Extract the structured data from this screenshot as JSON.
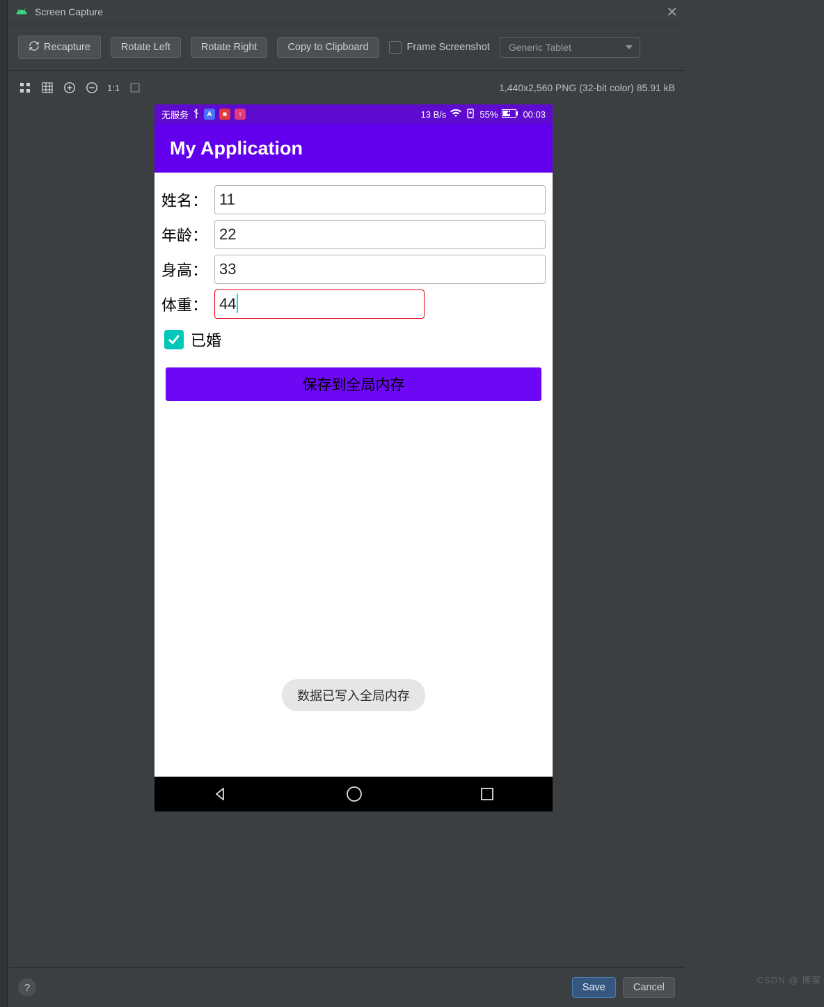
{
  "window": {
    "title": "Screen Capture"
  },
  "toolbar": {
    "recapture": "Recapture",
    "rotate_left": "Rotate Left",
    "rotate_right": "Rotate Right",
    "copy_clipboard": "Copy to Clipboard",
    "frame_screenshot": "Frame Screenshot",
    "device_dropdown": "Generic Tablet",
    "zoom_ratio": "1:1",
    "image_info": "1,440x2,560 PNG (32-bit color) 85.91 kB"
  },
  "device": {
    "status": {
      "carrier": "无服务",
      "speed": "13 B/s",
      "battery": "55%",
      "time": "00:03"
    },
    "app_title": "My Application",
    "form": {
      "name": {
        "label": "姓名：",
        "value": "11"
      },
      "age": {
        "label": "年龄：",
        "value": "22"
      },
      "height": {
        "label": "身高：",
        "value": "33"
      },
      "weight": {
        "label": "体重：",
        "value": "44"
      },
      "married_label": "已婚",
      "married_checked": true,
      "save_button": "保存到全局内存"
    },
    "toast": "数据已写入全局内存"
  },
  "footer": {
    "save": "Save",
    "cancel": "Cancel"
  },
  "watermark": "CSDN @ 博客"
}
